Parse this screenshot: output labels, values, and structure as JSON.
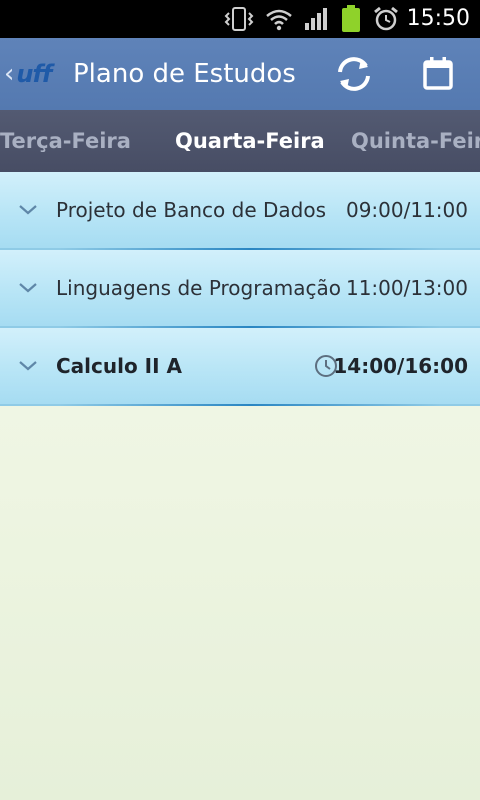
{
  "status_bar": {
    "time": "15:50",
    "icons": [
      "vibrate-icon",
      "wifi-icon",
      "signal-icon",
      "battery-icon",
      "alarm-icon"
    ]
  },
  "action_bar": {
    "logo_text": "uff",
    "title": "Plano de Estudos",
    "actions": [
      "refresh-icon",
      "calendar-icon"
    ]
  },
  "day_tabs": {
    "previous": "Terça-Feira",
    "current": "Quarta-Feira",
    "next": "Quinta-Feira"
  },
  "classes": [
    {
      "name": "Projeto de Banco de Dados",
      "time": "09:00/11:00",
      "active": false
    },
    {
      "name": "Linguagens de Programação",
      "time": "11:00/13:00",
      "active": false
    },
    {
      "name": "Calculo II A",
      "time": "14:00/16:00",
      "active": true
    }
  ],
  "colors": {
    "action_bar": "#5479b0",
    "tabs_bar": "#4b5168",
    "row_highlight": "#b8e5f6",
    "accent_line": "#2a86c2",
    "background": "#eef5e2"
  }
}
